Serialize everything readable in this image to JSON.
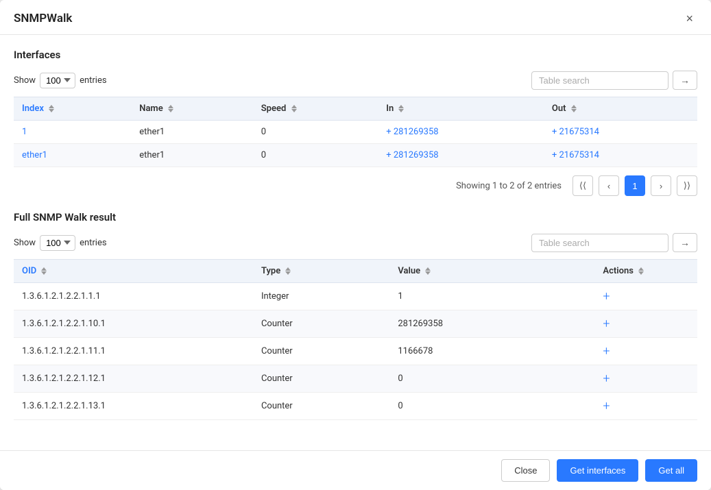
{
  "dialog": {
    "title": "SNMPWalk",
    "close_label": "×"
  },
  "interfaces_section": {
    "title": "Interfaces",
    "show_label": "Show",
    "entries_label": "entries",
    "entries_value": "100",
    "search_placeholder": "Table search",
    "search_icon": "→",
    "columns": [
      "Index",
      "Name",
      "Speed",
      "In",
      "Out"
    ],
    "rows": [
      {
        "index": "1",
        "name": "ether1",
        "speed": "0",
        "in": "+ 281269358",
        "out": "+ 21675314"
      },
      {
        "index": "ether1",
        "name": "ether1",
        "speed": "0",
        "in": "+ 281269358",
        "out": "+ 21675314"
      }
    ],
    "pagination": {
      "showing_text": "Showing 1 to 2 of 2 entries",
      "current_page": "1"
    }
  },
  "snmp_section": {
    "title": "Full SNMP Walk result",
    "show_label": "Show",
    "entries_label": "entries",
    "entries_value": "100",
    "search_placeholder": "Table search",
    "search_icon": "→",
    "columns": [
      "OID",
      "Type",
      "Value",
      "Actions"
    ],
    "rows": [
      {
        "oid": "1.3.6.1.2.1.2.2.1.1.1",
        "type": "Integer",
        "value": "1"
      },
      {
        "oid": "1.3.6.1.2.1.2.2.1.10.1",
        "type": "Counter",
        "value": "281269358"
      },
      {
        "oid": "1.3.6.1.2.1.2.2.1.11.1",
        "type": "Counter",
        "value": "1166678"
      },
      {
        "oid": "1.3.6.1.2.1.2.2.1.12.1",
        "type": "Counter",
        "value": "0"
      },
      {
        "oid": "1.3.6.1.2.1.2.2.1.13.1",
        "type": "Counter",
        "value": "0"
      }
    ]
  },
  "footer": {
    "close_label": "Close",
    "get_interfaces_label": "Get interfaces",
    "get_all_label": "Get all"
  }
}
